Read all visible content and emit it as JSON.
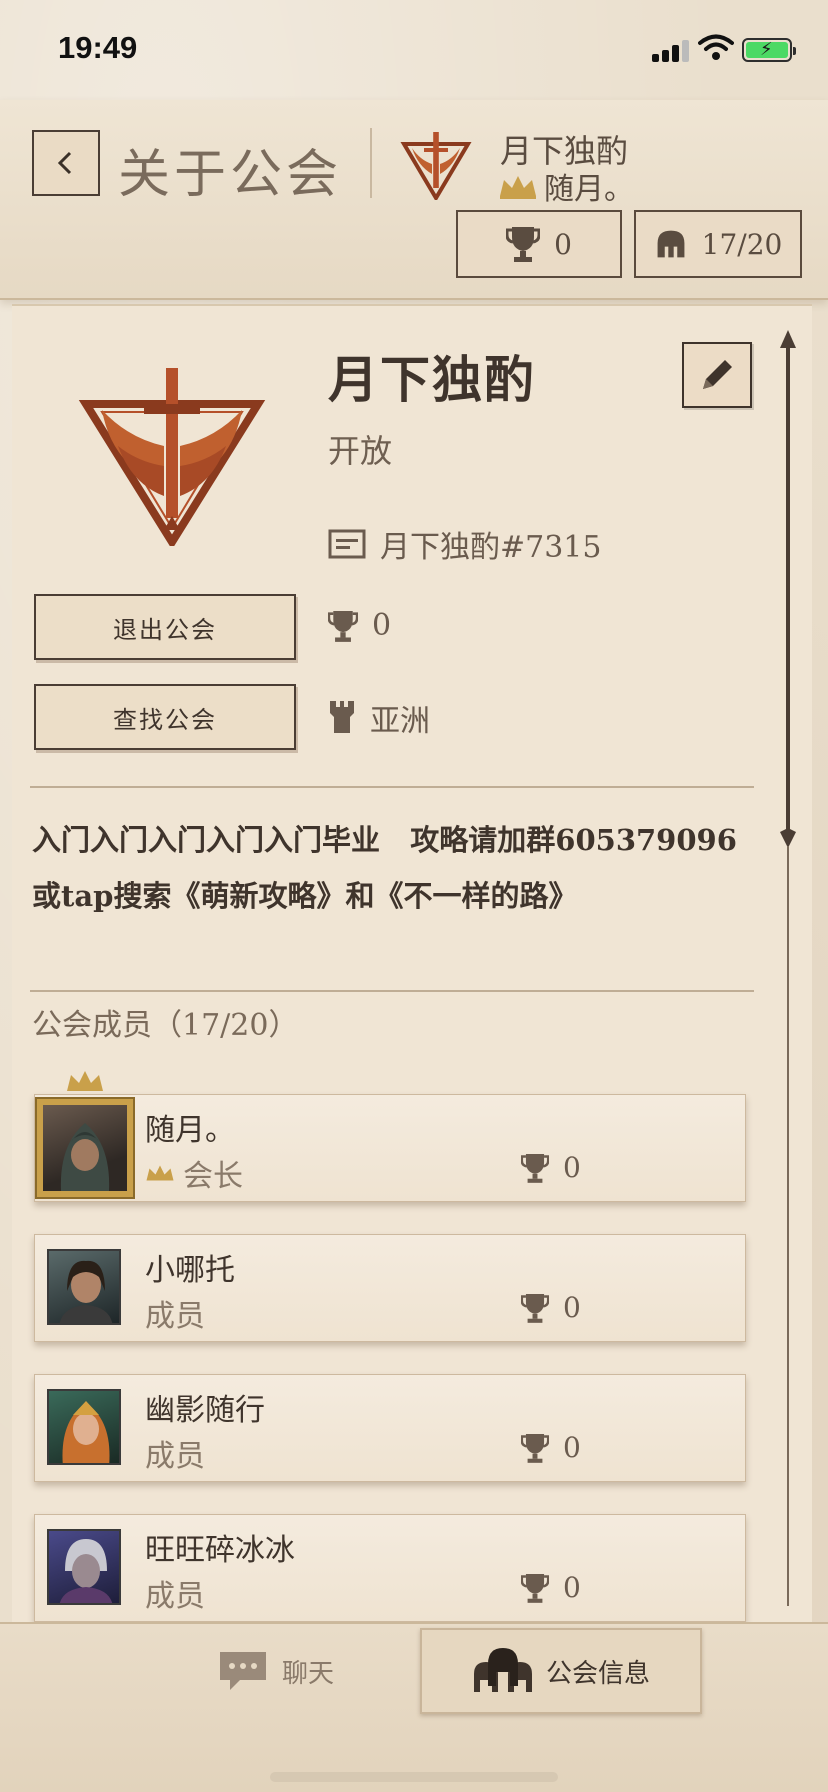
{
  "status_bar": {
    "time": "19:49"
  },
  "header": {
    "title": "关于公会",
    "guild_name": "月下独酌",
    "leader_name": "随月。",
    "trophies": "0",
    "members": "17/20"
  },
  "guild": {
    "name": "月下独酌",
    "status": "开放",
    "tag": "月下独酌#7315",
    "trophies": "0",
    "region": "亚洲",
    "leave_label": "退出公会",
    "find_label": "查找公会",
    "description": "入门入门入门入门入门毕业   攻略请加群605379096  或tap搜索《萌新攻略》和《不一样的路》"
  },
  "members_section": {
    "title": "公会成员（17/20）",
    "members": [
      {
        "name": "随月。",
        "role": "会长",
        "trophies": "0"
      },
      {
        "name": "小哪托",
        "role": "成员",
        "trophies": "0"
      },
      {
        "name": "幽影随行",
        "role": "成员",
        "trophies": "0"
      },
      {
        "name": "旺旺碎冰冰",
        "role": "成员",
        "trophies": "0"
      }
    ]
  },
  "tabs": {
    "chat": "聊天",
    "info": "公会信息"
  },
  "colors": {
    "accent": "#b5502a",
    "gold": "#c9a04a",
    "parchment": "#eadfcd"
  },
  "icons": [
    "back-arrow-icon",
    "guild-emblem-icon",
    "crown-icon",
    "trophy-icon",
    "helmet-icon",
    "edit-icon",
    "id-card-icon",
    "tower-icon",
    "chat-icon",
    "guild-info-icon"
  ]
}
